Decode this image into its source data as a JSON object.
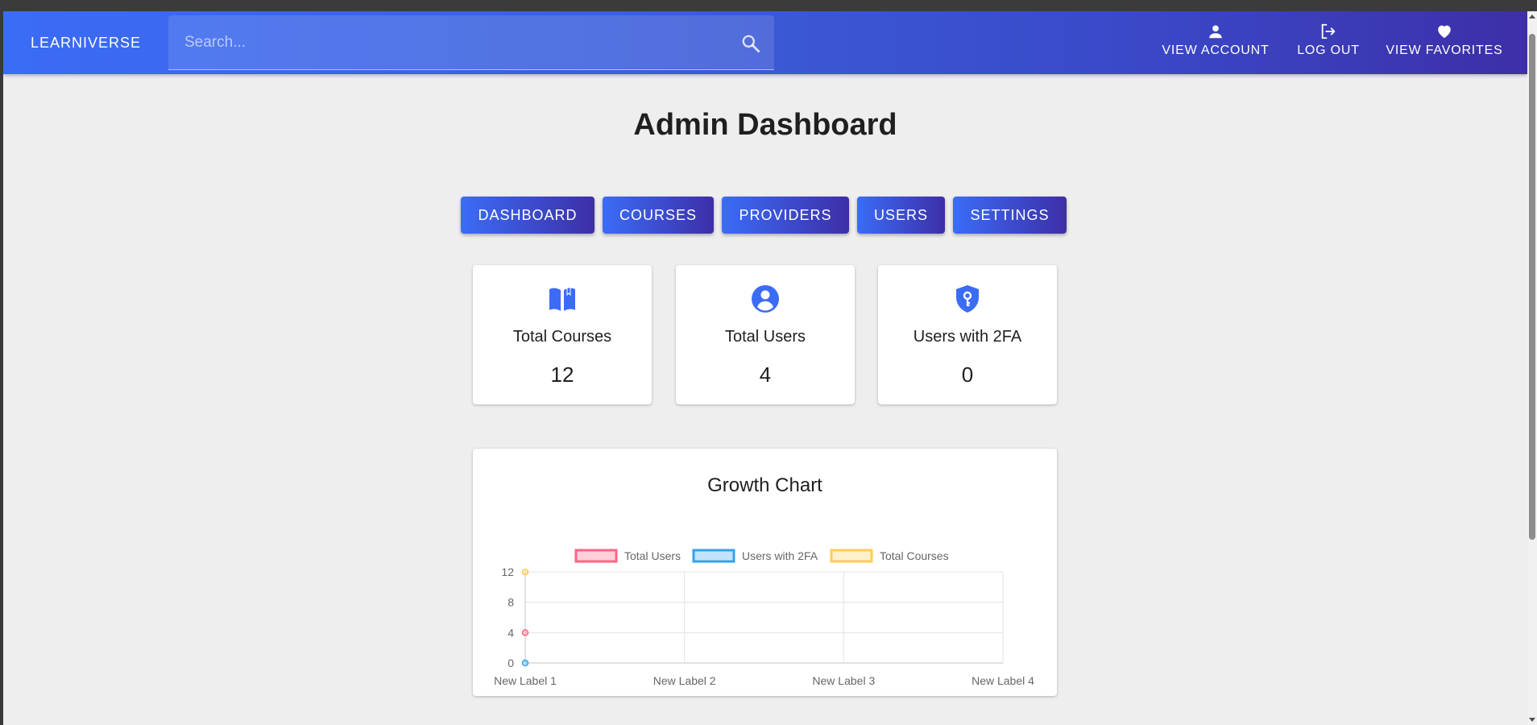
{
  "app": {
    "brand": "LEARNIVERSE"
  },
  "search": {
    "placeholder": "Search..."
  },
  "nav": {
    "account": "VIEW ACCOUNT",
    "logout": "LOG OUT",
    "favorites": "VIEW FAVORITES"
  },
  "page": {
    "title": "Admin Dashboard"
  },
  "tabs": [
    "DASHBOARD",
    "COURSES",
    "PROVIDERS",
    "USERS",
    "SETTINGS"
  ],
  "stats": [
    {
      "label": "Total Courses",
      "value": "12",
      "icon": "book-icon"
    },
    {
      "label": "Total Users",
      "value": "4",
      "icon": "user-circle-icon"
    },
    {
      "label": "Users with 2FA",
      "value": "0",
      "icon": "shield-key-icon"
    }
  ],
  "colors": {
    "accent": "#3b6cf6",
    "accent_dark": "#3d2fa7",
    "series_users": "#ff6384",
    "series_2fa": "#36a2eb",
    "series_courses": "#ffcd56"
  },
  "chart_data": {
    "type": "line",
    "title": "Growth Chart",
    "categories": [
      "New Label 1",
      "New Label 2",
      "New Label 3",
      "New Label 4"
    ],
    "series": [
      {
        "name": "Total Users",
        "values": [
          4
        ],
        "color": "#ff6384"
      },
      {
        "name": "Users with 2FA",
        "values": [
          0
        ],
        "color": "#36a2eb"
      },
      {
        "name": "Total Courses",
        "values": [
          12
        ],
        "color": "#ffcd56"
      }
    ],
    "yticks": [
      0,
      4,
      8,
      12
    ],
    "ylim": [
      0,
      12
    ],
    "grid": true,
    "legend": "top"
  }
}
